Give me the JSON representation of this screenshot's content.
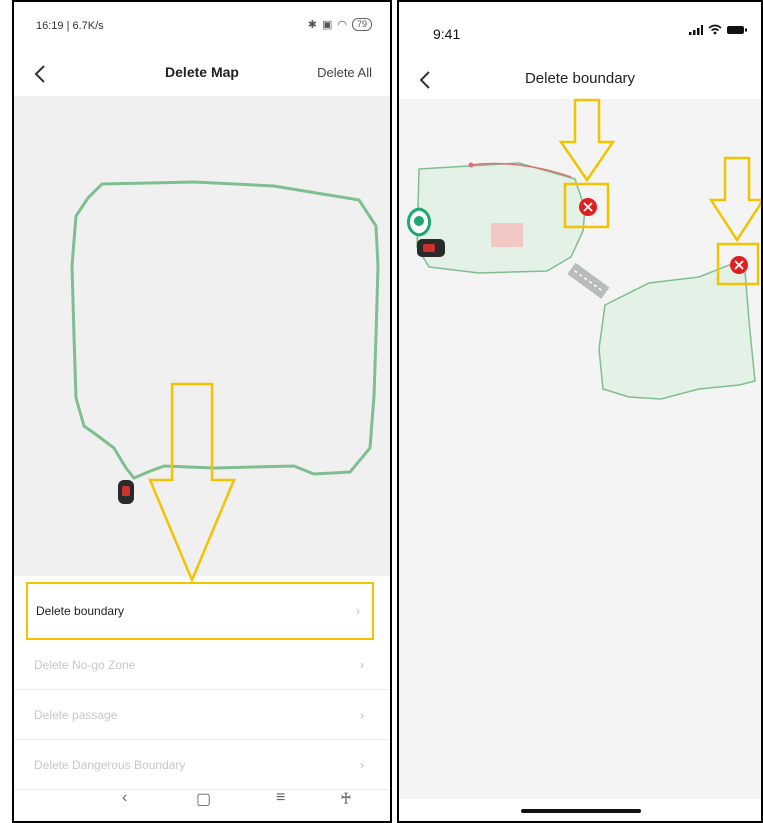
{
  "left_screen": {
    "status_bar": {
      "time": "16:19 | 6.7K/s",
      "battery": "79"
    },
    "header": {
      "title": "Delete Map",
      "action": "Delete All"
    },
    "menu": [
      {
        "label": "Delete boundary",
        "state": "active"
      },
      {
        "label": "Delete No-go Zone",
        "state": "disabled"
      },
      {
        "label": "Delete passage",
        "state": "disabled"
      },
      {
        "label": "Delete Dangerous Boundary",
        "state": "disabled"
      }
    ],
    "nav_icons": [
      "back-icon",
      "home-icon",
      "menu-icon",
      "accessibility-icon"
    ]
  },
  "right_screen": {
    "status_bar": {
      "time": "9:41"
    },
    "header": {
      "title": "Delete boundary"
    }
  },
  "colors": {
    "highlight": "#f2c300",
    "boundary": "#7fbf8f",
    "boundary_fill": "#e3f1e6",
    "delete_marker": "#e02020",
    "station": "#1aa873"
  }
}
